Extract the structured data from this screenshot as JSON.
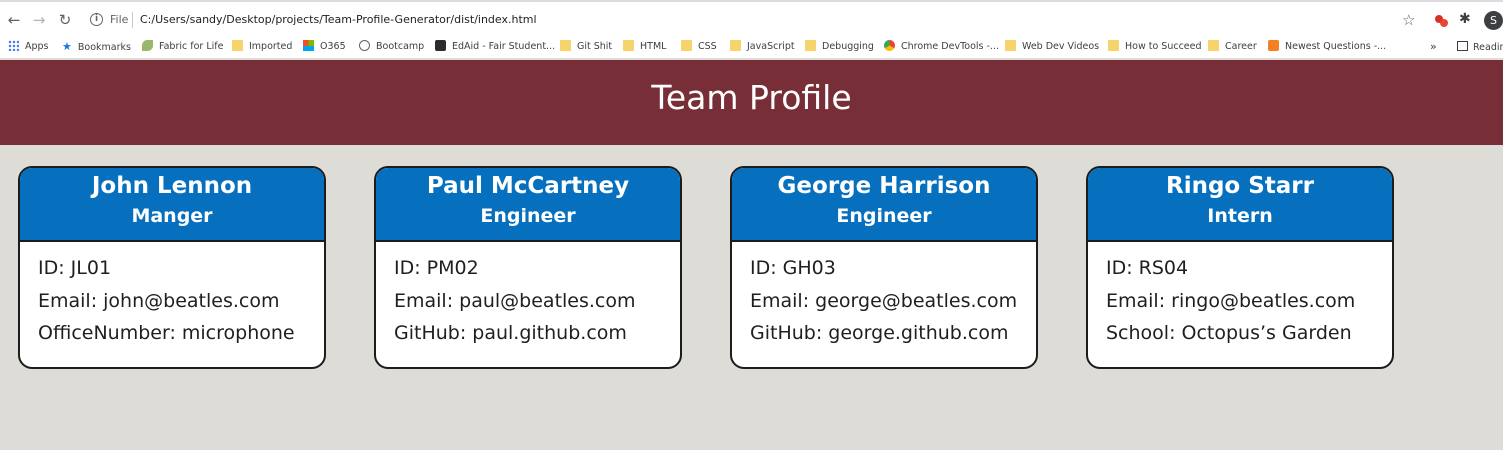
{
  "browser": {
    "file_label": "File",
    "url": "C:/Users/sandy/Desktop/projects/Team-Profile-Generator/dist/index.html",
    "profile_initial": "S",
    "bookmarks": [
      {
        "label": "Apps",
        "icon": "apps-grid-icon"
      },
      {
        "label": "Bookmarks",
        "icon": "star-icon"
      },
      {
        "label": "Fabric for Life",
        "icon": "leaf-icon"
      },
      {
        "label": "Imported",
        "icon": "folder-icon"
      },
      {
        "label": "O365",
        "icon": "office-icon"
      },
      {
        "label": "Bootcamp",
        "icon": "globe-icon"
      },
      {
        "label": "EdAid - Fair Student...",
        "icon": "cap-icon"
      },
      {
        "label": "Git Shit",
        "icon": "folder-icon"
      },
      {
        "label": "HTML",
        "icon": "folder-icon"
      },
      {
        "label": "CSS",
        "icon": "folder-icon"
      },
      {
        "label": "JavaScript",
        "icon": "folder-icon"
      },
      {
        "label": "Debugging",
        "icon": "folder-icon"
      },
      {
        "label": "Chrome DevTools -...",
        "icon": "chrome-icon"
      },
      {
        "label": "Web Dev Videos",
        "icon": "folder-icon"
      },
      {
        "label": "How to Succeed",
        "icon": "folder-icon"
      },
      {
        "label": "Career",
        "icon": "folder-icon"
      },
      {
        "label": "Newest Questions -...",
        "icon": "stack-overflow-icon"
      }
    ],
    "more_label": "»",
    "reading_list_label": "Readin"
  },
  "page": {
    "title": "Team Profile",
    "colors": {
      "banner": "#782e37",
      "card_header": "#0770be",
      "background": "#dedcd7"
    },
    "team": [
      {
        "name": "John Lennon",
        "role": "Manger",
        "id_line": "ID: JL01",
        "email_line": "Email: john@beatles.com",
        "extra_line": "OfficeNumber: microphone"
      },
      {
        "name": "Paul McCartney",
        "role": "Engineer",
        "id_line": "ID: PM02",
        "email_line": "Email: paul@beatles.com",
        "extra_line": "GitHub: paul.github.com"
      },
      {
        "name": "George Harrison",
        "role": "Engineer",
        "id_line": "ID: GH03",
        "email_line": "Email: george@beatles.com",
        "extra_line": "GitHub: george.github.com"
      },
      {
        "name": "Ringo Starr",
        "role": "Intern",
        "id_line": "ID: RS04",
        "email_line": "Email: ringo@beatles.com",
        "extra_line": "School: Octopus’s Garden"
      }
    ]
  }
}
